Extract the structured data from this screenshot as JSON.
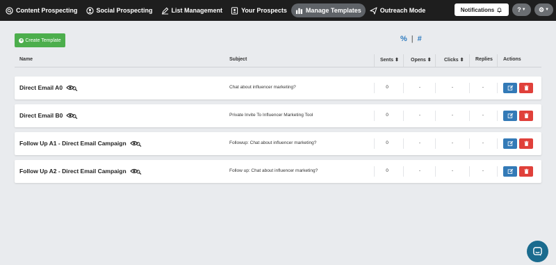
{
  "nav": {
    "items": [
      {
        "label": "Content Prospecting",
        "icon": "search-icon"
      },
      {
        "label": "Social Prospecting",
        "icon": "user-circle-icon"
      },
      {
        "label": "List Management",
        "icon": "pen-icon"
      },
      {
        "label": "Your Prospects",
        "icon": "contact-card-icon"
      },
      {
        "label": "Manage Templates",
        "icon": "templates-icon"
      },
      {
        "label": "Outreach Mode",
        "icon": "paper-plane-icon"
      }
    ],
    "notifications_label": "Notifications",
    "help_label": "?",
    "settings_label": "⚙"
  },
  "toolbar": {
    "create_label": "Create Template",
    "percent_label": "%",
    "separator": "|",
    "hash_label": "#"
  },
  "table": {
    "headers": {
      "name": "Name",
      "subject": "Subject",
      "sents": "Sents",
      "opens": "Opens",
      "clicks": "Clicks",
      "replies": "Replies",
      "actions": "Actions"
    },
    "rows": [
      {
        "name": "Direct Email A0",
        "subject": "Chat about influencer marketing?",
        "sents": "0",
        "opens": "-",
        "clicks": "-",
        "replies": "-"
      },
      {
        "name": "Direct Email B0",
        "subject": "Private Invite To Influencer Marketing Tool",
        "sents": "0",
        "opens": "-",
        "clicks": "-",
        "replies": "-"
      },
      {
        "name": "Follow Up A1 - Direct Email Campaign",
        "subject": "Followup: Chat about influencer marketing?",
        "sents": "0",
        "opens": "-",
        "clicks": "-",
        "replies": "-"
      },
      {
        "name": "Follow Up A2 - Direct Email Campaign",
        "subject": "Follow up: Chat about influencer marketing?",
        "sents": "0",
        "opens": "-",
        "clicks": "-",
        "replies": "-"
      }
    ]
  },
  "colors": {
    "nav_bg": "#1e1e1e",
    "create_green": "#4cae4c",
    "edit_blue": "#337ab7",
    "delete_red": "#e0403a",
    "chat_bg": "#1a6b8e"
  }
}
